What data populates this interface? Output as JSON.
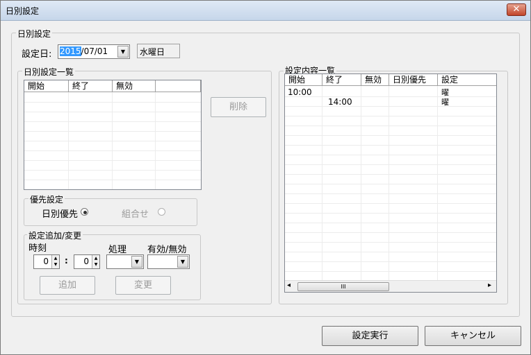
{
  "window": {
    "title": "日別設定",
    "close": "✕"
  },
  "main_group": {
    "legend": "日別設定"
  },
  "date": {
    "label": "設定日:",
    "year": "2015",
    "rest": "/07/01",
    "weekday": "水曜日"
  },
  "daily_list": {
    "legend": "日別設定一覧",
    "columns": [
      "開始",
      "終了",
      "無効"
    ]
  },
  "delete_button": "削除",
  "priority": {
    "legend": "優先設定",
    "daily_label": "日別優先",
    "combo_label": "組合せ"
  },
  "add_change": {
    "legend": "設定追加/変更",
    "time_label": "時刻",
    "process_label": "処理",
    "valid_label": "有効/無効",
    "hour_value": "0",
    "minute_value": "0",
    "colon": ":",
    "add_button": "追加",
    "change_button": "変更"
  },
  "content_list": {
    "legend": "設定内容一覧",
    "columns": [
      "開始",
      "終了",
      "無効",
      "日別優先",
      "設定"
    ],
    "rows": [
      {
        "start": "10:00",
        "end": "",
        "setting": "曜"
      },
      {
        "start": "",
        "end": "14:00",
        "setting": "曜"
      }
    ],
    "scroll_left": "◂",
    "scroll_right": "▸",
    "scroll_thumb": "III"
  },
  "footer": {
    "execute": "設定実行",
    "cancel": "キャンセル"
  }
}
